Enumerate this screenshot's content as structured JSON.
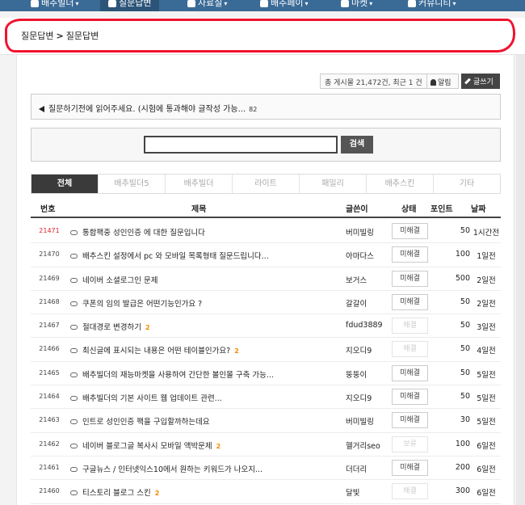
{
  "nav": {
    "items": [
      {
        "label": "배추빌더",
        "active": false
      },
      {
        "label": "질문답변",
        "active": true
      },
      {
        "label": "자료실",
        "active": false
      },
      {
        "label": "배추페이",
        "active": false
      },
      {
        "label": "마켓",
        "active": false
      },
      {
        "label": "커뮤니티",
        "active": false
      }
    ]
  },
  "breadcrumb": {
    "first": "질문답변",
    "second": "질문답변"
  },
  "toolbar": {
    "stats": "총 게시물 21,472건, 최근 1 건",
    "alarm_label": "알림",
    "write_label": "글쓰기"
  },
  "notice": {
    "text": "질문하기전에 읽어주세요. (시험에 통과해야 글작성 가능...",
    "count": "82"
  },
  "search": {
    "value": "",
    "button_label": "검색"
  },
  "tabs": [
    "전체",
    "배추빌더5",
    "배추빌더",
    "라이트",
    "패밀리",
    "배추스킨",
    "기타"
  ],
  "table": {
    "headers": {
      "num": "번호",
      "title": "제목",
      "author": "글쓴이",
      "state": "상태",
      "points": "포인트",
      "date": "날짜"
    },
    "rows": [
      {
        "num": "21471",
        "title": "통합팩중 성인인증 에 대한 질문입니다",
        "badge": "",
        "author": "버미빌링",
        "state": "미해결",
        "points": "50",
        "date": "1시간전"
      },
      {
        "num": "21470",
        "title": "배추스킨 설정에서 pc 와 모바일 목록형태 질문드립니다...",
        "badge": "",
        "author": "아마다스",
        "state": "미해결",
        "points": "100",
        "date": "1일전"
      },
      {
        "num": "21469",
        "title": "네이버 소셜로그인 문제",
        "badge": "",
        "author": "보거스",
        "state": "미해결",
        "points": "500",
        "date": "2일전"
      },
      {
        "num": "21468",
        "title": "쿠폰의 임의 발급은 어떤기능인가요 ?",
        "badge": "",
        "author": "갈갈이",
        "state": "미해결",
        "points": "50",
        "date": "2일전"
      },
      {
        "num": "21467",
        "title": "절대경로 변경하기",
        "badge": "2",
        "author": "fdud3889",
        "state": "해결",
        "points": "50",
        "date": "3일전"
      },
      {
        "num": "21466",
        "title": "최신글에 표시되는 내용은 어떤 테이블인가요?",
        "badge": "2",
        "author": "지오디9",
        "state": "해결",
        "points": "50",
        "date": "4일전"
      },
      {
        "num": "21465",
        "title": "배추빌더의 재능마켓을 사용하여 간단한 볼인몰 구축 가능...",
        "badge": "",
        "author": "뚱뚱이",
        "state": "미해결",
        "points": "50",
        "date": "5일전"
      },
      {
        "num": "21464",
        "title": "배추빌더의 기본 사이트 웹 업데이트 관련...",
        "badge": "",
        "author": "지오디9",
        "state": "미해결",
        "points": "50",
        "date": "5일전"
      },
      {
        "num": "21463",
        "title": "인트로 성인인증 팩을 구입할까하는데요",
        "badge": "",
        "author": "버미빌링",
        "state": "미해결",
        "points": "30",
        "date": "5일전"
      },
      {
        "num": "21462",
        "title": "네이버 블로그글 복사시 모바일 액박문제",
        "badge": "2",
        "author": "헬거리seo",
        "state": "보류",
        "points": "100",
        "date": "6일전"
      },
      {
        "num": "21461",
        "title": "구글뉴스 / 인터넷익스10에서 원하는 키워드가 나오지...",
        "badge": "",
        "author": "더더리",
        "state": "미해결",
        "points": "200",
        "date": "6일전"
      },
      {
        "num": "21460",
        "title": "티스토리 블로그 스킨",
        "badge": "2",
        "author": "달빛",
        "state": "해결",
        "points": "300",
        "date": "6일전"
      }
    ]
  }
}
